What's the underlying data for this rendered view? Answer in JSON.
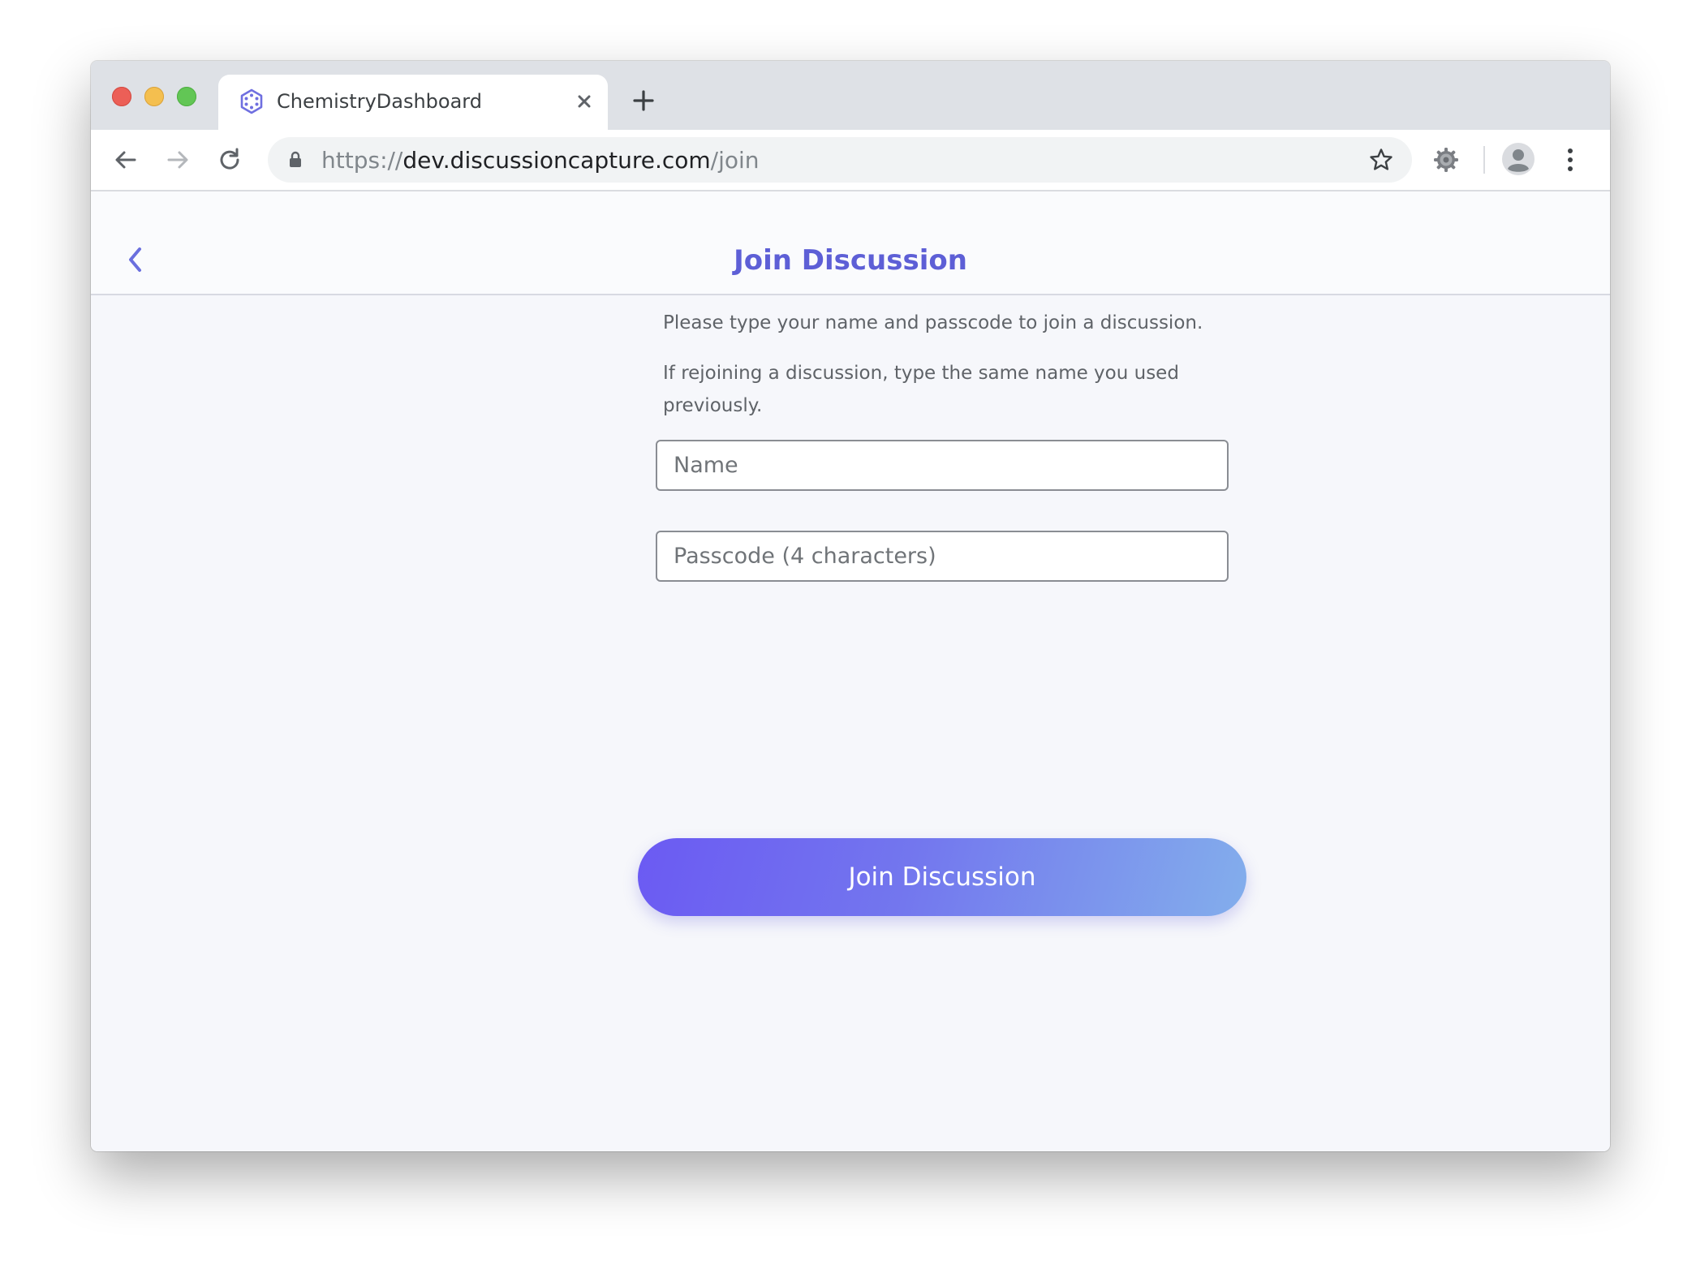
{
  "browser": {
    "tab": {
      "title": "ChemistryDashboard",
      "favicon": "hexagon-molecule-icon"
    },
    "address_bar": {
      "scheme": "https://",
      "host": "dev.discussioncapture.com",
      "path": "/join"
    },
    "icons": {
      "back": "back-arrow-icon",
      "forward": "forward-arrow-icon",
      "reload": "reload-icon",
      "lock": "lock-icon",
      "bookmark": "star-icon",
      "extension": "gear-icon",
      "profile": "avatar-icon",
      "menu": "kebab-menu-icon",
      "new_tab": "plus-icon",
      "close_tab": "close-icon"
    }
  },
  "page": {
    "title": "Join Discussion",
    "back_icon": "chevron-left-icon",
    "instructions": [
      "Please type your name and passcode to join a discussion.",
      "If rejoining a discussion, type the same name you used previously."
    ],
    "form": {
      "name_placeholder": "Name",
      "name_value": "",
      "passcode_placeholder": "Passcode (4 characters)",
      "passcode_value": "",
      "submit_label": "Join Discussion"
    }
  },
  "colors": {
    "accent": "#5d5fd6",
    "button_gradient_start": "#6b5af3",
    "button_gradient_end": "#83aeec",
    "page_background": "#f6f7fb"
  }
}
